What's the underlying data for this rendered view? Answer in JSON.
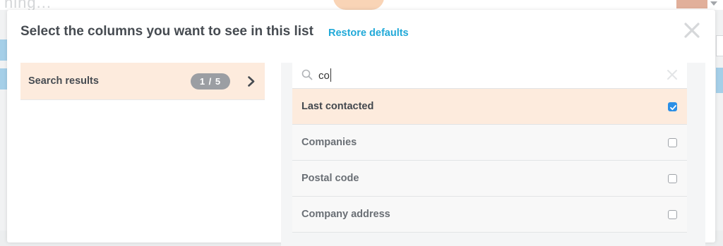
{
  "background": {
    "truncated_text": "ning..."
  },
  "modal": {
    "title": "Select the columns you want to see in this list",
    "restore_label": "Restore defaults",
    "close_icon": "close-icon",
    "accent_color": "#20a9d8"
  },
  "category": {
    "label": "Search results",
    "count": "1 / 5",
    "icon": "chevron-right-icon"
  },
  "search": {
    "value": "co",
    "placeholder": "",
    "icon": "search-icon",
    "clear_icon": "clear-icon"
  },
  "options": [
    {
      "label": "Last contacted",
      "checked": true
    },
    {
      "label": "Companies",
      "checked": false
    },
    {
      "label": "Postal code",
      "checked": false
    },
    {
      "label": "Company address",
      "checked": false
    }
  ],
  "colors": {
    "selected_row": "#fdebdd",
    "checkbox_checked": "#2b8fe6"
  }
}
